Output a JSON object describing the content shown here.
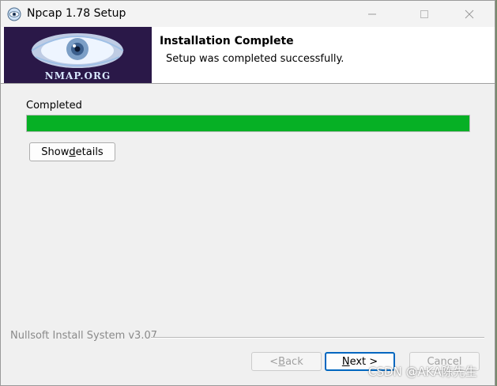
{
  "window": {
    "title": "Npcap 1.78 Setup",
    "controls": {
      "minimize": "—",
      "maximize": "☐",
      "close": "✕"
    }
  },
  "header": {
    "logo_text": "NMAP.ORG",
    "title": "Installation Complete",
    "subtitle": "Setup was completed successfully."
  },
  "main": {
    "status_label": "Completed",
    "progress_percent": 100,
    "progress_color": "#06b025",
    "show_details": {
      "before": "Show ",
      "underlined": "d",
      "after": "etails"
    }
  },
  "footer": {
    "brand": "Nullsoft Install System v3.07",
    "back": {
      "before": "< ",
      "underlined": "B",
      "after": "ack"
    },
    "next": {
      "before": "",
      "underlined": "N",
      "after": "ext >"
    },
    "cancel": "Cancel"
  },
  "watermark": "CSDN @AKA陈先生"
}
